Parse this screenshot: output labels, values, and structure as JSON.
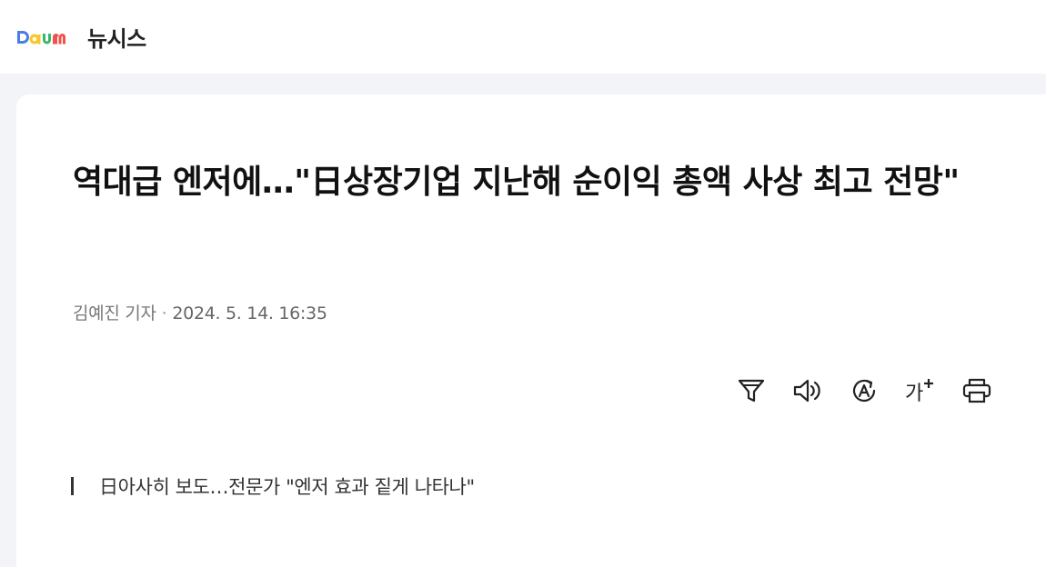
{
  "header": {
    "logo_text": "Daum",
    "press_name": "뉴시스"
  },
  "article": {
    "title": "역대급 엔저에…\"日상장기업 지난해 순이익 총액 사상 최고 전망\"",
    "reporter": "김예진 기자",
    "separator": "·",
    "datetime": "2024. 5. 14. 16:35",
    "subtitle": "日아사히 보도…전문가 \"엔저 효과 짙게 나타나\""
  },
  "toolbar": {
    "icons": [
      "filter-icon",
      "speaker-icon",
      "translate-icon",
      "font-size-icon",
      "print-icon"
    ],
    "font_size_label": "가"
  },
  "colors": {
    "logo_blue": "#4a7de8",
    "logo_yellow": "#f7c72e",
    "logo_green": "#38b76c",
    "logo_red": "#f0524a",
    "page_bg": "#f3f4f7"
  }
}
